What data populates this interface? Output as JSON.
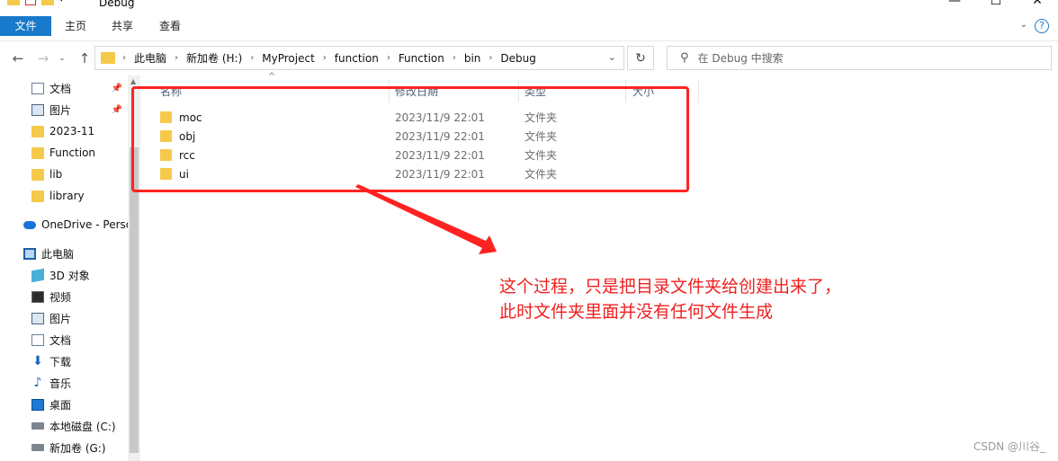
{
  "window": {
    "title": "Debug"
  },
  "ribbon": {
    "tabs": [
      "文件",
      "主页",
      "共享",
      "查看"
    ],
    "help": "?"
  },
  "address": {
    "crumbs": [
      "此电脑",
      "新加卷 (H:)",
      "MyProject",
      "function",
      "Function",
      "bin",
      "Debug"
    ]
  },
  "search": {
    "placeholder": "在 Debug 中搜索"
  },
  "sidebar": {
    "items": [
      {
        "label": "文档",
        "icon": "document-icon",
        "pinned": true
      },
      {
        "label": "图片",
        "icon": "picture-icon",
        "pinned": true
      },
      {
        "label": "2023-11",
        "icon": "folder-icon"
      },
      {
        "label": "Function",
        "icon": "folder-icon"
      },
      {
        "label": "lib",
        "icon": "folder-icon"
      },
      {
        "label": "library",
        "icon": "folder-icon"
      },
      {
        "label": "OneDrive - Personal",
        "icon": "onedrive-icon"
      },
      {
        "label": "此电脑",
        "icon": "computer-icon"
      },
      {
        "label": "3D 对象",
        "icon": "3d-objects-icon"
      },
      {
        "label": "视频",
        "icon": "video-icon"
      },
      {
        "label": "图片",
        "icon": "picture-icon"
      },
      {
        "label": "文档",
        "icon": "document-icon"
      },
      {
        "label": "下载",
        "icon": "download-icon"
      },
      {
        "label": "音乐",
        "icon": "music-icon"
      },
      {
        "label": "桌面",
        "icon": "desktop-icon"
      },
      {
        "label": "本地磁盘 (C:)",
        "icon": "drive-icon"
      },
      {
        "label": "新加卷 (G:)",
        "icon": "drive-icon"
      }
    ]
  },
  "columns": {
    "name": "名称",
    "modified": "修改日期",
    "type": "类型",
    "size": "大小"
  },
  "files": [
    {
      "name": "moc",
      "modified": "2023/11/9 22:01",
      "type": "文件夹"
    },
    {
      "name": "obj",
      "modified": "2023/11/9 22:01",
      "type": "文件夹"
    },
    {
      "name": "rcc",
      "modified": "2023/11/9 22:01",
      "type": "文件夹"
    },
    {
      "name": "ui",
      "modified": "2023/11/9 22:01",
      "type": "文件夹"
    }
  ],
  "annotation": {
    "line1": "这个过程，只是把目录文件夹给创建出来了，",
    "line2": "此时文件夹里面并没有任何文件生成",
    "color": "#f02020"
  },
  "watermark": "CSDN @川谷_"
}
